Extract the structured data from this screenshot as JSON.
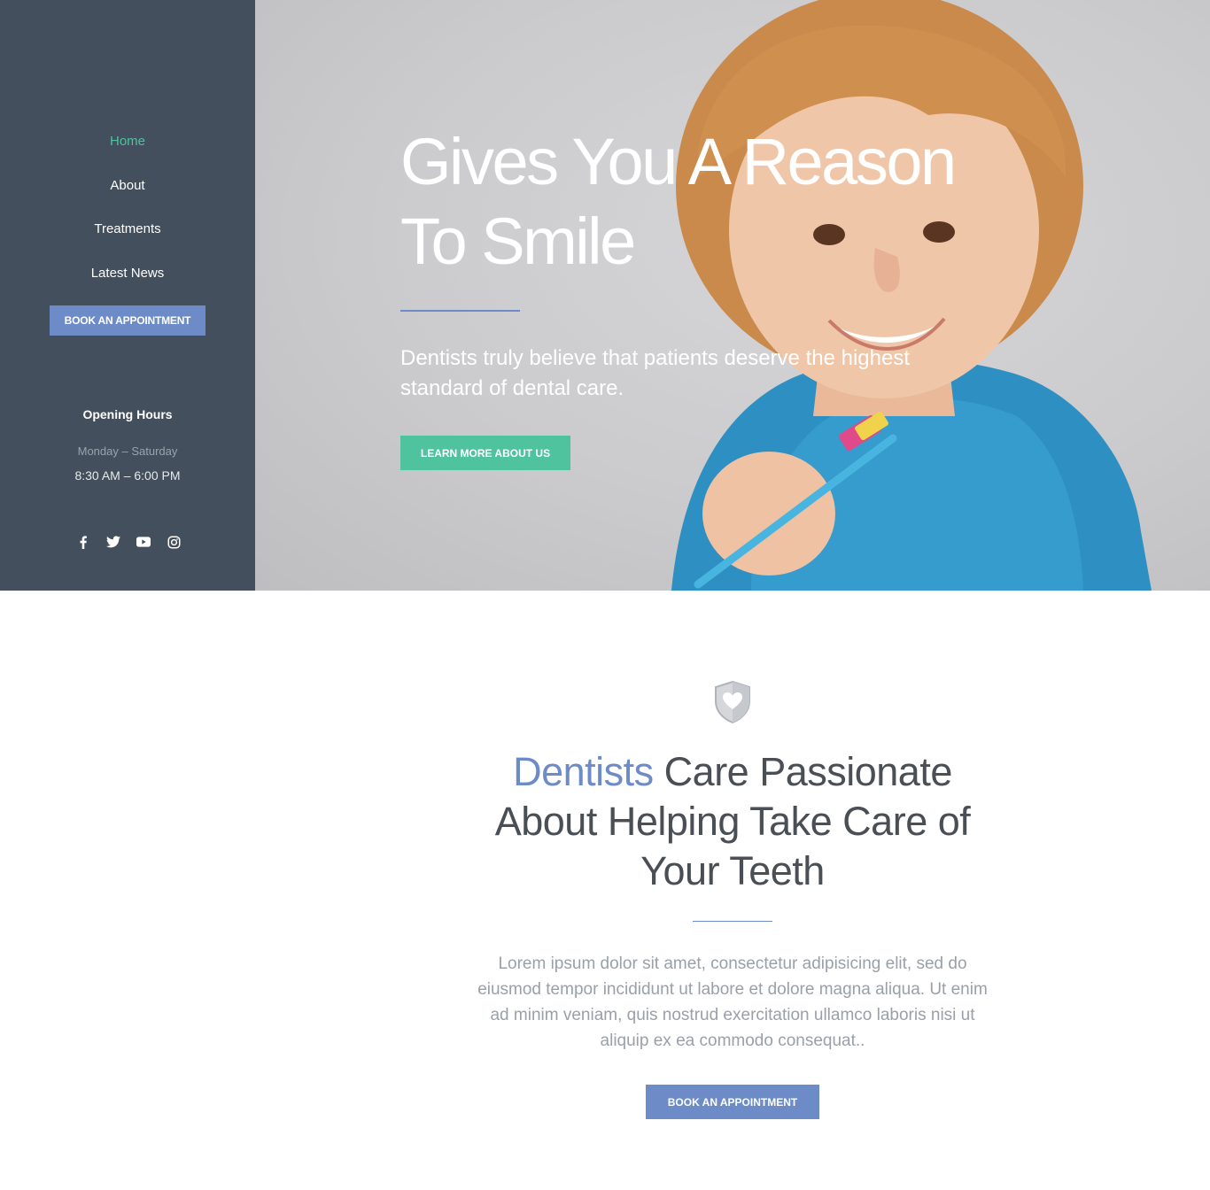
{
  "sidebar": {
    "nav": [
      {
        "label": "Home",
        "active": true
      },
      {
        "label": "About"
      },
      {
        "label": "Treatments"
      },
      {
        "label": "Latest News"
      }
    ],
    "cta_label": "BOOK AN APPOINTMENT",
    "hours_title": "Opening Hours",
    "hours_days": "Monday – Saturday",
    "hours_time": "8:30 AM – 6:00 PM",
    "socials": [
      "facebook-icon",
      "twitter-icon",
      "youtube-icon",
      "instagram-icon"
    ]
  },
  "hero": {
    "title_line1": "Gives You A Reason",
    "title_line2": "To Smile",
    "subtitle": "Dentists truly believe that patients deserve the highest standard of dental care.",
    "cta_label": "LEARN MORE ABOUT US"
  },
  "main": {
    "icon": "shield-heart-icon",
    "title_accent": "Dentists",
    "title_rest": " Care Passionate About Helping Take Care of Your Teeth",
    "text": "Lorem ipsum dolor sit amet, consectetur adipisicing elit, sed do eiusmod tempor incididunt ut labore et dolore magna aliqua. Ut enim ad minim veniam, quis nostrud exercitation ullamco laboris nisi ut aliquip ex ea commodo consequat..",
    "cta_label": "BOOK AN APPOINTMENT"
  },
  "colors": {
    "sidebar_bg": "#434f5c",
    "accent_blue": "#6d8cc7",
    "accent_green": "#4ec39e"
  }
}
